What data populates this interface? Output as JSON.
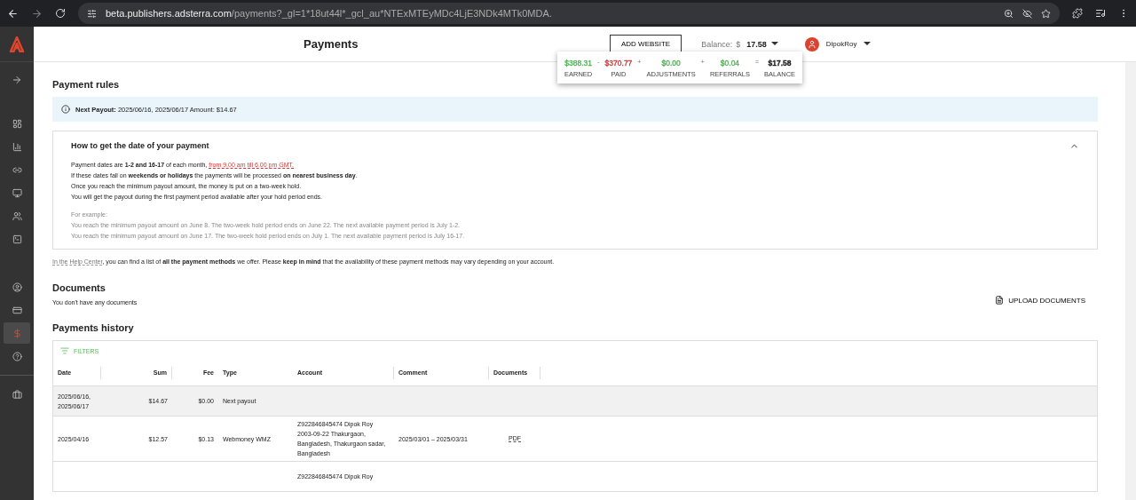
{
  "browser": {
    "url_host": "beta.publishers.adsterra.com",
    "url_path": "/payments?_gl=1*18ut44l*_gcl_au*NTExMTEyMDc4LjE3NDk4MTk0MDA."
  },
  "sidebar": {
    "items": [
      {
        "selected": false
      },
      {
        "selected": false
      },
      {
        "selected": false
      },
      {
        "selected": false
      },
      {
        "selected": false
      },
      {
        "selected": false
      },
      {
        "selected": false
      },
      {
        "selected": false
      },
      {
        "selected": true
      },
      {
        "selected": false
      },
      {
        "selected": false
      }
    ]
  },
  "header": {
    "title": "Payments",
    "add_button": "ADD WEBSITE",
    "balance_label": "Balance:",
    "balance_currency": "$",
    "balance_value": "17.58",
    "user_name": "DipokRoy"
  },
  "balance_popup": {
    "items": [
      {
        "amount": "$388.31",
        "label": "EARNED",
        "sign": "-",
        "color": "#4caf50"
      },
      {
        "amount": "$370.77",
        "label": "PAID",
        "sign": "+",
        "color": "#cc3333"
      },
      {
        "amount": "$0.00",
        "label": "ADJUSTMENTS",
        "sign": "+",
        "color": "#4caf50"
      },
      {
        "amount": "$0.04",
        "label": "REFERRALS",
        "sign": "=",
        "color": "#4caf50"
      },
      {
        "amount": "$17.58",
        "label": "BALANCE",
        "color": "#222222"
      }
    ]
  },
  "payment_rules": {
    "title": "Payment rules",
    "notice": "**Next Payout:** 2025/06/16, 2025/06/17 Amount: $14.67",
    "accordion": {
      "title": "How to get the date of your payment",
      "expanded": true,
      "lines": [
        {
          "text": "Payment dates are **1-2 and 16-17** of each month, ",
          "link": "from 9.00 am till 6.00 pm GMT."
        },
        {
          "text": "If these dates fall on **weekends or holidays** the payments will be processed **on nearest business day**."
        },
        {
          "text": "Once you reach the minimum payout amount, the money is put on a two-week hold."
        },
        {
          "text": "You will get the payout during the first payment period available after your hold period ends."
        }
      ],
      "example_title": "For example:",
      "examples": [
        "You reach the minimum payout amount on June 8. The two-week hold period ends on June 22. The next available payment period is July 1-2.",
        "You reach the minimum payout amount on June 17. The two-week hold period ends on July 1. The next available payment period is July 16-17."
      ]
    },
    "help_link": "In the Help Center",
    "help_text": ", you can find a list of **all the payment methods** we offer. Please **keep in mind** that the availability of these payment methods may vary depending on your account."
  },
  "documents": {
    "title": "Documents",
    "empty_text": "You don't have any documents",
    "upload_button": "UPLOAD DOCUMENTS"
  },
  "history": {
    "title": "Payments history",
    "filters": "FILTERS",
    "columns": [
      "Date",
      "Sum",
      "Fee",
      "Type",
      "Account",
      "Comment",
      "Documents"
    ],
    "rows": [
      {
        "highlighted": true,
        "date": "2025/06/16, 2025/06/17",
        "sum": "$14.67",
        "fee": "$0.00",
        "type": "Next payout"
      },
      {
        "highlighted": false,
        "date": "2025/04/16",
        "sum": "$12.57",
        "fee": "$0.13",
        "type": "Webmoney WMZ",
        "account": "Z922846845474 Dipok Roy 2003-09-22 Thakurgaon, Bangladesh, Thakurgaon sadar, Bangladesh",
        "comment": "2025/03/01 – 2025/03/31",
        "document": "PDF"
      },
      {
        "highlighted": false,
        "account": "Z922846845474 Dipok Roy"
      }
    ]
  }
}
